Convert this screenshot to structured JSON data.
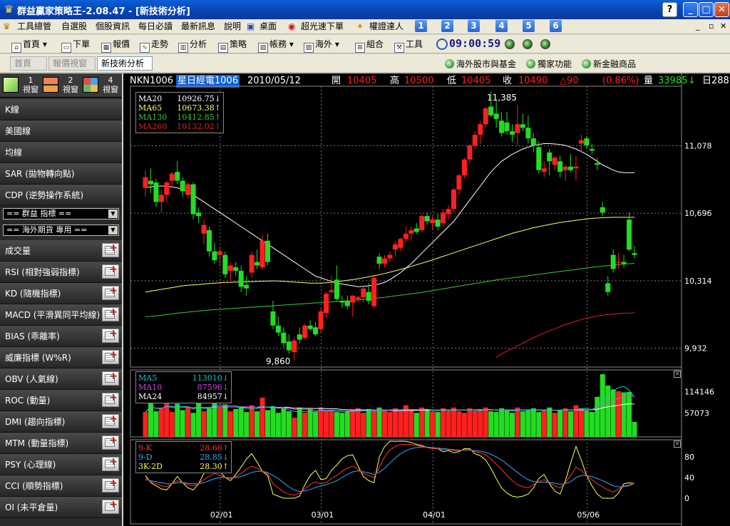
{
  "window": {
    "title": "群益贏家策略王-2.08.47 - [新技術分析]",
    "help_label": "?",
    "min_label": "_",
    "max_label": "□",
    "close_label": "✕"
  },
  "menu": {
    "items": [
      "工具總管",
      "自選股",
      "個股資訊",
      "每日必讀",
      "最新訊息",
      "說明",
      "桌面",
      "超光速下單",
      "權證達人"
    ],
    "number_buttons": [
      "1",
      "2",
      "3",
      "4",
      "5",
      "6"
    ],
    "mdi_controls": [
      "_",
      "▫",
      "✕"
    ]
  },
  "toolbar": {
    "items": [
      "首頁",
      "下單",
      "報價",
      "走勢",
      "分析",
      "策略",
      "帳務",
      "海外",
      "組合",
      "工具"
    ],
    "clock": "09:00:59"
  },
  "tabs": {
    "items": [
      "首頁",
      "報價視窗",
      "新技術分析"
    ],
    "active_index": 2,
    "links": [
      "海外股市與基金",
      "獨家功能",
      "新金融商品"
    ]
  },
  "sidebar": {
    "view_buttons": [
      {
        "num": "1",
        "label": "視窗"
      },
      {
        "num": "2",
        "label": "視窗"
      },
      {
        "num": "4",
        "label": "視窗"
      }
    ],
    "top_items": [
      "K線",
      "美國線",
      "均線",
      "SAR (拋物轉向點)",
      "CDP (逆勢操作系統)"
    ],
    "selects": [
      "== 群益 指標 ==",
      "== 海外期貨 專用 =="
    ],
    "indicators": [
      "成交量",
      "RSI (相對強弱指標)",
      "KD (隨機指標)",
      "MACD (平滑異同平均線)",
      "BIAS (乖離率)",
      "威廉指標 (W%R)",
      "OBV (人氣線)",
      "ROC (動量)",
      "DMI (趨向指標)",
      "MTM (動量指標)",
      "PSY (心理線)",
      "CCI (順勢指標)",
      "OI (未平倉量)"
    ]
  },
  "quote": {
    "symbol": "NKN1006",
    "name": "星日經電1006",
    "date": "2010/05/12",
    "open_label": "開",
    "open": "10405",
    "high_label": "高",
    "high": "10500",
    "low_label": "低",
    "low": "10405",
    "close_label": "收",
    "close": "10490",
    "change": "△90",
    "change_pct": "(0.86%)",
    "volume_label": "量",
    "volume": "33985",
    "volume_arrow": "↓",
    "period": "日288"
  },
  "colors": {
    "up": "#ff2020",
    "down": "#22dd22",
    "ma20": "#ffffff",
    "ma65": "#ffff66",
    "ma130": "#33cc33",
    "ma260": "#dd2222",
    "ma5": "#00cccc",
    "ma10": "#dd44dd",
    "ma24": "#ffffff",
    "k_line": "#ff3333",
    "d_line": "#33aaff",
    "j_line": "#ffff55"
  },
  "legends": {
    "price": [
      {
        "name": "MA20",
        "value": "10926.75",
        "arrow": "↓"
      },
      {
        "name": "MA65",
        "value": "10673.38",
        "arrow": "↑"
      },
      {
        "name": "MA130",
        "value": "10412.85",
        "arrow": "↑"
      },
      {
        "name": "MA260",
        "value": "10132.02",
        "arrow": "↑"
      }
    ],
    "volume": [
      {
        "name": "MA5",
        "value": "113010",
        "arrow": "↓"
      },
      {
        "name": "MA10",
        "value": "87596",
        "arrow": "↓"
      },
      {
        "name": "MA24",
        "value": "84957",
        "arrow": "↓"
      }
    ],
    "kd": [
      {
        "name": "9-K",
        "value": "28.66",
        "arrow": "↑"
      },
      {
        "name": "9-D",
        "value": "28.85",
        "arrow": "↓"
      },
      {
        "name": "3K-2D",
        "value": "28.30",
        "arrow": "↑"
      }
    ]
  },
  "chart_data": {
    "type": "candlestick",
    "x_ticks": [
      "02/01",
      "03/01",
      "04/01",
      "05/06"
    ],
    "price_axis": [
      "11,078",
      "10,696",
      "10,314",
      "9,932"
    ],
    "price_range": [
      9825,
      11415
    ],
    "high_annotation": "11,385",
    "low_annotation": "9,860",
    "volume_axis": [
      "114146",
      "57073"
    ],
    "kd_axis": [
      "80",
      "40",
      "0"
    ],
    "candles": [
      [
        10840,
        10940,
        10790,
        10900
      ],
      [
        10880,
        10950,
        10810,
        10860
      ],
      [
        10870,
        10890,
        10730,
        10760
      ],
      [
        10760,
        10830,
        10700,
        10800
      ],
      [
        10800,
        10880,
        10760,
        10870
      ],
      [
        10880,
        10930,
        10840,
        10920
      ],
      [
        10930,
        10990,
        10860,
        10880
      ],
      [
        10880,
        10900,
        10790,
        10820
      ],
      [
        10800,
        10870,
        10780,
        10860
      ],
      [
        10860,
        10870,
        10660,
        10690
      ],
      [
        10700,
        10730,
        10640,
        10680
      ],
      [
        10580,
        10660,
        10520,
        10630
      ],
      [
        10600,
        10620,
        10450,
        10480
      ],
      [
        10480,
        10530,
        10410,
        10430
      ],
      [
        10460,
        10500,
        10400,
        10480
      ],
      [
        10460,
        10480,
        10330,
        10350
      ],
      [
        10370,
        10420,
        10320,
        10400
      ],
      [
        10390,
        10420,
        10340,
        10370
      ],
      [
        10370,
        10400,
        10250,
        10280
      ],
      [
        10290,
        10340,
        10230,
        10270
      ],
      [
        10360,
        10480,
        10330,
        10460
      ],
      [
        10420,
        10490,
        10380,
        10400
      ],
      [
        10390,
        10570,
        10380,
        10540
      ],
      [
        10540,
        10580,
        10400,
        10420
      ],
      [
        10140,
        10200,
        10040,
        10060
      ],
      [
        10060,
        10110,
        10000,
        10020
      ],
      [
        10020,
        10050,
        9935,
        9960
      ],
      [
        9970,
        10010,
        9900,
        9920
      ],
      [
        9910,
        9990,
        9860,
        9975
      ],
      [
        10010,
        10050,
        9960,
        9980
      ],
      [
        9990,
        10070,
        9980,
        10060
      ],
      [
        10060,
        10090,
        10030,
        10040
      ],
      [
        10050,
        10080,
        10000,
        10010
      ],
      [
        10040,
        10160,
        10020,
        10140
      ],
      [
        10130,
        10250,
        10100,
        10240
      ],
      [
        10250,
        10340,
        10240,
        10260
      ],
      [
        10320,
        10400,
        10200,
        10210
      ],
      [
        10200,
        10230,
        10160,
        10190
      ],
      [
        10200,
        10230,
        10150,
        10170
      ],
      [
        10190,
        10230,
        10110,
        10230
      ],
      [
        10210,
        10230,
        10190,
        10220
      ],
      [
        10220,
        10280,
        10190,
        10270
      ],
      [
        10250,
        10300,
        10180,
        10200
      ],
      [
        10170,
        10340,
        10160,
        10330
      ],
      [
        10450,
        10470,
        10380,
        10410
      ],
      [
        10410,
        10460,
        10390,
        10440
      ],
      [
        10440,
        10480,
        10420,
        10460
      ],
      [
        10490,
        10540,
        10450,
        10520
      ],
      [
        10500,
        10560,
        10480,
        10550
      ],
      [
        10550,
        10620,
        10530,
        10580
      ],
      [
        10580,
        10620,
        10540,
        10600
      ],
      [
        10610,
        10640,
        10580,
        10590
      ],
      [
        10600,
        10690,
        10590,
        10680
      ],
      [
        10680,
        10700,
        10630,
        10650
      ],
      [
        10640,
        10680,
        10600,
        10660
      ],
      [
        10660,
        10690,
        10600,
        10620
      ],
      [
        10640,
        10720,
        10620,
        10700
      ],
      [
        10690,
        10740,
        10660,
        10720
      ],
      [
        10720,
        10840,
        10700,
        10830
      ],
      [
        10830,
        10920,
        10800,
        10910
      ],
      [
        10910,
        11010,
        10890,
        11000
      ],
      [
        11000,
        11090,
        10980,
        11080
      ],
      [
        11080,
        11160,
        11060,
        11140
      ],
      [
        11140,
        11220,
        11090,
        11200
      ],
      [
        11200,
        11300,
        11180,
        11290
      ],
      [
        11300,
        11385,
        11240,
        11250
      ],
      [
        11260,
        11340,
        11180,
        11230
      ],
      [
        11220,
        11270,
        11130,
        11150
      ],
      [
        11210,
        11270,
        11140,
        11160
      ],
      [
        11160,
        11200,
        11100,
        11140
      ],
      [
        11150,
        11310,
        11080,
        11200
      ],
      [
        11200,
        11260,
        11160,
        11180
      ],
      [
        11180,
        11250,
        11090,
        11120
      ],
      [
        11120,
        11150,
        11040,
        11080
      ],
      [
        11070,
        11100,
        10920,
        10940
      ],
      [
        10930,
        10990,
        10900,
        10950
      ],
      [
        11040,
        11060,
        10910,
        10990
      ],
      [
        10970,
        11020,
        10940,
        11010
      ],
      [
        10990,
        11020,
        10900,
        10930
      ],
      [
        10940,
        10970,
        10880,
        10960
      ],
      [
        10960,
        11030,
        10930,
        10940
      ],
      [
        10950,
        11020,
        10880,
        10960
      ],
      [
        11090,
        11140,
        11040,
        11110
      ],
      [
        11120,
        11130,
        11060,
        11080
      ],
      [
        11060,
        11090,
        11030,
        11050
      ],
      [
        10980,
        11010,
        10940,
        10970
      ],
      [
        10730,
        10760,
        10680,
        10700
      ],
      [
        10300,
        10340,
        10230,
        10250
      ],
      [
        10460,
        10490,
        10360,
        10380
      ],
      [
        10420,
        10470,
        10380,
        10420
      ],
      [
        10420,
        10460,
        10390,
        10410
      ],
      [
        10660,
        10700,
        10480,
        10490
      ],
      [
        10470,
        10510,
        10440,
        10460
      ]
    ],
    "ma20": [
      10840,
      10845,
      10850,
      10850,
      10848,
      10845,
      10840,
      10830,
      10815,
      10800,
      10780,
      10760,
      10740,
      10720,
      10700,
      10680,
      10660,
      10640,
      10620,
      10600,
      10580,
      10560,
      10540,
      10520,
      10500,
      10480,
      10460,
      10440,
      10420,
      10400,
      10380,
      10360,
      10340,
      10330,
      10320,
      10310,
      10300,
      10295,
      10290,
      10285,
      10280,
      10282,
      10285,
      10290,
      10295,
      10305,
      10320,
      10340,
      10360,
      10385,
      10410,
      10440,
      10470,
      10500,
      10530,
      10560,
      10590,
      10620,
      10650,
      10690,
      10730,
      10770,
      10810,
      10850,
      10890,
      10930,
      10960,
      10990,
      11010,
      11030,
      11045,
      11060,
      11070,
      11080,
      11085,
      11090,
      11090,
      11088,
      11085,
      11080,
      11070,
      11060,
      11045,
      11030,
      11010,
      10990,
      10970,
      10955,
      10940,
      10930,
      10926,
      10926,
      10926
    ],
    "ma65": [
      10250,
      10255,
      10260,
      10265,
      10270,
      10275,
      10280,
      10285,
      10288,
      10290,
      10292,
      10295,
      10298,
      10300,
      10302,
      10304,
      10305,
      10306,
      10307,
      10308,
      10309,
      10310,
      10311,
      10312,
      10313,
      10312,
      10310,
      10308,
      10306,
      10304,
      10302,
      10300,
      10300,
      10300,
      10302,
      10305,
      10308,
      10312,
      10316,
      10320,
      10325,
      10330,
      10336,
      10342,
      10348,
      10355,
      10362,
      10370,
      10378,
      10386,
      10395,
      10404,
      10413,
      10422,
      10432,
      10442,
      10452,
      10462,
      10472,
      10482,
      10492,
      10502,
      10512,
      10522,
      10532,
      10542,
      10552,
      10562,
      10572,
      10582,
      10590,
      10598,
      10606,
      10614,
      10620,
      10626,
      10632,
      10638,
      10643,
      10648,
      10652,
      10656,
      10660,
      10664,
      10667,
      10669,
      10671,
      10672,
      10673,
      10673,
      10673,
      10673,
      10673
    ],
    "ma130": [
      10110,
      10112,
      10115,
      10118,
      10122,
      10126,
      10130,
      10133,
      10136,
      10139,
      10142,
      10145,
      10148,
      10150,
      10152,
      10154,
      10156,
      10158,
      10160,
      10162,
      10164,
      10166,
      10168,
      10170,
      10172,
      10174,
      10176,
      10178,
      10180,
      10182,
      10184,
      10186,
      10188,
      10190,
      10192,
      10194,
      10196,
      10198,
      10200,
      10202,
      10205,
      10208,
      10211,
      10214,
      10217,
      10220,
      10224,
      10228,
      10232,
      10236,
      10240,
      10244,
      10248,
      10253,
      10258,
      10263,
      10268,
      10273,
      10278,
      10283,
      10288,
      10293,
      10298,
      10303,
      10308,
      10313,
      10318,
      10322,
      10326,
      10330,
      10334,
      10338,
      10342,
      10346,
      10350,
      10354,
      10358,
      10362,
      10366,
      10370,
      10374,
      10378,
      10382,
      10386,
      10390,
      10393,
      10396,
      10399,
      10402,
      10405,
      10408,
      10410,
      10412
    ],
    "ma260": [
      null,
      null,
      null,
      null,
      null,
      null,
      null,
      null,
      null,
      null,
      null,
      null,
      null,
      null,
      null,
      null,
      null,
      null,
      null,
      null,
      null,
      null,
      null,
      null,
      null,
      null,
      null,
      null,
      null,
      null,
      null,
      null,
      null,
      null,
      null,
      null,
      null,
      null,
      null,
      null,
      null,
      null,
      null,
      null,
      null,
      null,
      null,
      null,
      null,
      null,
      null,
      null,
      null,
      null,
      null,
      null,
      null,
      null,
      null,
      null,
      null,
      null,
      null,
      null,
      null,
      null,
      9880,
      9900,
      9915,
      9930,
      9945,
      9960,
      9975,
      9990,
      10005,
      10018,
      10030,
      10042,
      10054,
      10065,
      10075,
      10085,
      10094,
      10102,
      10108,
      10114,
      10118,
      10122,
      10125,
      10128,
      10130,
      10131,
      10132
    ],
    "volumes": [
      60000,
      88000,
      62000,
      70000,
      95000,
      60000,
      82000,
      65000,
      72000,
      58000,
      90000,
      62000,
      70000,
      100000,
      72000,
      80000,
      62000,
      68000,
      75000,
      60000,
      78000,
      62000,
      98000,
      65000,
      72000,
      58000,
      70000,
      62000,
      45000,
      70000,
      58000,
      68000,
      60000,
      72000,
      65000,
      62000,
      60000,
      58000,
      62000,
      66000,
      70000,
      58000,
      68000,
      62000,
      72000,
      66000,
      60000,
      70000,
      62000,
      78000,
      64000,
      58000,
      72000,
      66000,
      62000,
      60000,
      70000,
      65000,
      72000,
      62000,
      58000,
      70000,
      63000,
      68000,
      72000,
      62000,
      60000,
      70000,
      64000,
      58000,
      72000,
      62000,
      66000,
      70000,
      60000,
      64000,
      72000,
      58000,
      66000,
      70000,
      62000,
      78000,
      70000,
      64000,
      60000,
      100000,
      160000,
      130000,
      120000,
      115000,
      112000,
      113010,
      33985
    ],
    "k": [
      40,
      32,
      28,
      24,
      22,
      28,
      34,
      30,
      26,
      24,
      28,
      36,
      42,
      48,
      44,
      40,
      38,
      42,
      48,
      56,
      62,
      58,
      52,
      48,
      28,
      20,
      12,
      8,
      6,
      10,
      18,
      26,
      32,
      28,
      30,
      38,
      44,
      52,
      58,
      62,
      56,
      48,
      44,
      40,
      60,
      80,
      94,
      100,
      104,
      104,
      104,
      102,
      100,
      98,
      96,
      96,
      94,
      94,
      92,
      92,
      94,
      94,
      90,
      88,
      84,
      76,
      66,
      56,
      44,
      34,
      26,
      22,
      20,
      26,
      32,
      36,
      30,
      24,
      20,
      30,
      44,
      60,
      54,
      44,
      36,
      28,
      22,
      16,
      12,
      18,
      24,
      26,
      28.66
    ],
    "d": [
      36,
      34,
      32,
      30,
      28,
      28,
      30,
      30,
      29,
      28,
      28,
      30,
      34,
      38,
      40,
      40,
      40,
      40,
      42,
      46,
      50,
      52,
      52,
      50,
      44,
      38,
      30,
      22,
      16,
      13,
      14,
      17,
      21,
      24,
      26,
      30,
      34,
      40,
      46,
      51,
      53,
      51,
      49,
      46,
      50,
      58,
      68,
      78,
      86,
      92,
      96,
      98,
      99,
      99,
      98,
      97,
      96,
      95,
      94,
      93,
      93,
      93,
      92,
      91,
      89,
      85,
      80,
      74,
      66,
      58,
      50,
      42,
      36,
      32,
      31,
      31,
      31,
      29,
      27,
      28,
      32,
      40,
      44,
      44,
      42,
      38,
      34,
      29,
      24,
      22,
      22,
      24,
      28.85
    ],
    "j": [
      44,
      30,
      24,
      18,
      16,
      28,
      42,
      30,
      20,
      16,
      28,
      48,
      58,
      68,
      52,
      40,
      34,
      46,
      60,
      76,
      86,
      70,
      52,
      44,
      8,
      4,
      0,
      0,
      0,
      4,
      26,
      44,
      54,
      36,
      38,
      54,
      64,
      76,
      82,
      84,
      62,
      42,
      34,
      30,
      80,
      100,
      112,
      110,
      112,
      110,
      108,
      104,
      102,
      98,
      96,
      96,
      90,
      92,
      88,
      90,
      96,
      96,
      86,
      82,
      74,
      58,
      38,
      20,
      10,
      4,
      2,
      4,
      8,
      20,
      38,
      46,
      28,
      14,
      8,
      34,
      68,
      100,
      74,
      44,
      24,
      8,
      0,
      0,
      0,
      10,
      28,
      30,
      28.3
    ]
  }
}
